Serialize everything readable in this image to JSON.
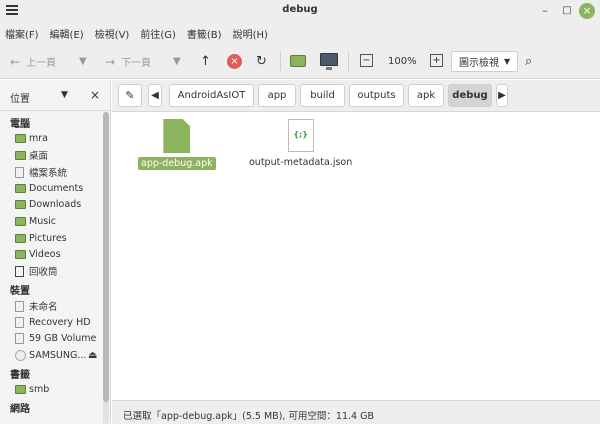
{
  "window": {
    "title": "debug"
  },
  "menubar": [
    "檔案(F)",
    "編輯(E)",
    "檢視(V)",
    "前往(G)",
    "書籤(B)",
    "說明(H)"
  ],
  "toolbar": {
    "back_label": "上一頁",
    "forward_label": "下一頁",
    "zoom_level": "100%",
    "view_mode": "圖示檢視"
  },
  "sidebar": {
    "header": "位置",
    "sections": [
      {
        "title": "電腦",
        "items": [
          "mra",
          "桌面",
          "檔案系統",
          "Documents",
          "Downloads",
          "Music",
          "Pictures",
          "Videos",
          "回收筒"
        ]
      },
      {
        "title": "裝置",
        "items": [
          "未命名",
          "Recovery HD",
          "59 GB Volume",
          "SAMSUNG..."
        ]
      },
      {
        "title": "書籤",
        "items": [
          "smb"
        ]
      },
      {
        "title": "網路",
        "items": []
      }
    ]
  },
  "pathbar": [
    "AndroidAsIOT",
    "app",
    "build",
    "outputs",
    "apk",
    "debug"
  ],
  "files": [
    {
      "name": "app-debug.apk",
      "selected": true
    },
    {
      "name": "output-metadata.json",
      "selected": false
    }
  ],
  "status": "已選取「app-debug.apk」(5.5 MB), 可用空間：11.4 GB",
  "colors": {
    "accent": "#8cb35d",
    "stop": "#e25b5b"
  }
}
